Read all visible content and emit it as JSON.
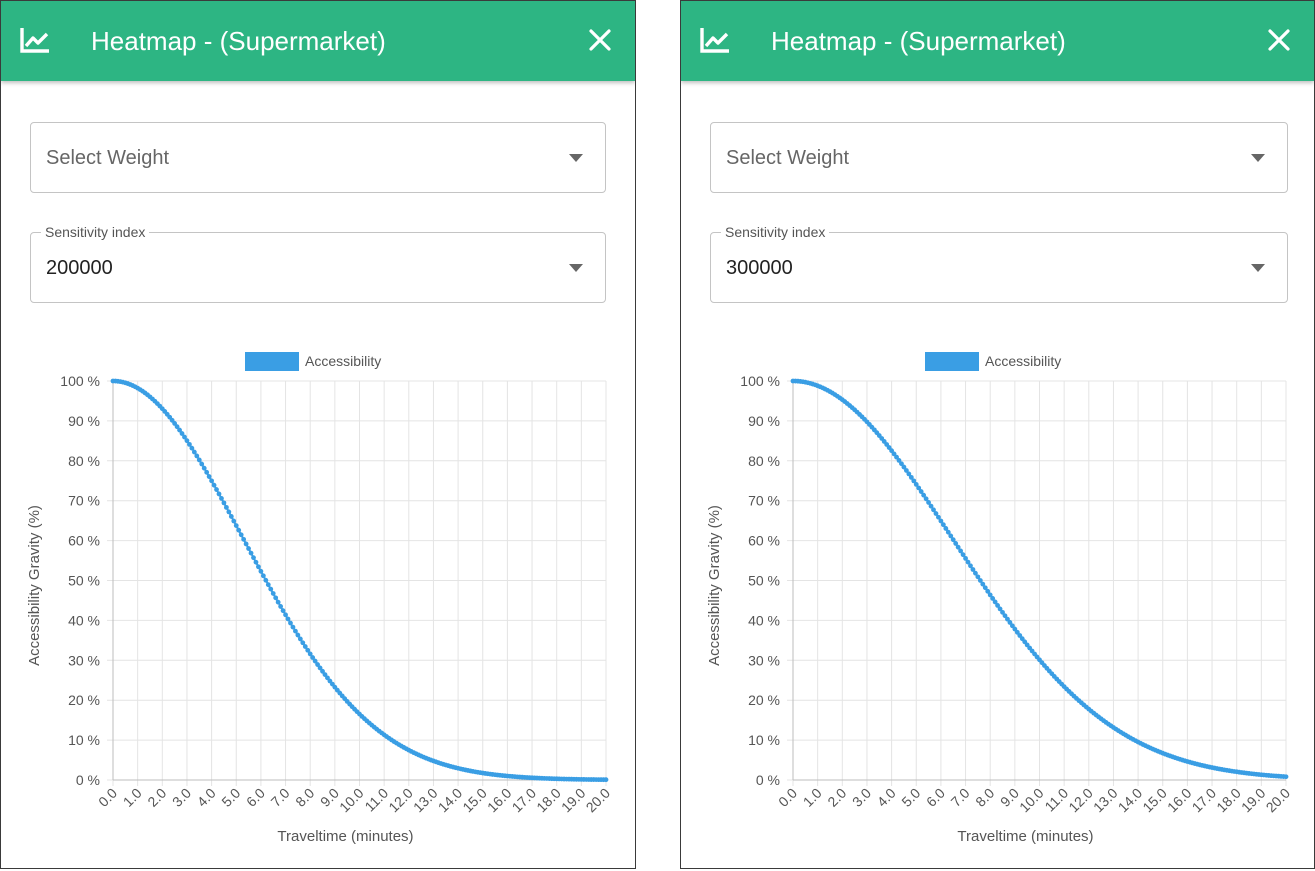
{
  "panels": [
    {
      "header": {
        "title": "Heatmap - (Supermarket)",
        "icon": "chart-line-icon",
        "close_icon": "close-icon"
      },
      "weight_select": {
        "placeholder": "Select Weight"
      },
      "sensitivity_select": {
        "label": "Sensitivity index",
        "value": "200000"
      },
      "legend": {
        "label": "Accessibility",
        "color": "#3a9ee4"
      },
      "chart_data": {
        "type": "line",
        "series": [
          {
            "name": "Accessibility",
            "sensitivity": 200000
          }
        ],
        "x_ticks": [
          "0.0",
          "1.0",
          "2.0",
          "3.0",
          "4.0",
          "5.0",
          "6.0",
          "7.0",
          "8.0",
          "9.0",
          "10.0",
          "11.0",
          "12.0",
          "13.0",
          "14.0",
          "15.0",
          "16.0",
          "17.0",
          "18.0",
          "19.0",
          "20.0"
        ],
        "y_ticks": [
          "0 %",
          "10 %",
          "20 %",
          "30 %",
          "40 %",
          "50 %",
          "60 %",
          "70 %",
          "80 %",
          "90 %",
          "100 %"
        ],
        "xlabel": "Traveltime (minutes)",
        "ylabel": "Accessibility Gravity (%)",
        "xlim": [
          0,
          20
        ],
        "ylim": [
          0,
          100
        ],
        "grid": true,
        "legend_position": "top"
      }
    },
    {
      "header": {
        "title": "Heatmap - (Supermarket)",
        "icon": "chart-line-icon",
        "close_icon": "close-icon"
      },
      "weight_select": {
        "placeholder": "Select Weight"
      },
      "sensitivity_select": {
        "label": "Sensitivity index",
        "value": "300000"
      },
      "legend": {
        "label": "Accessibility",
        "color": "#3a9ee4"
      },
      "chart_data": {
        "type": "line",
        "series": [
          {
            "name": "Accessibility",
            "sensitivity": 300000
          }
        ],
        "x_ticks": [
          "0.0",
          "1.0",
          "2.0",
          "3.0",
          "4.0",
          "5.0",
          "6.0",
          "7.0",
          "8.0",
          "9.0",
          "10.0",
          "11.0",
          "12.0",
          "13.0",
          "14.0",
          "15.0",
          "16.0",
          "17.0",
          "18.0",
          "19.0",
          "20.0"
        ],
        "y_ticks": [
          "0 %",
          "10 %",
          "20 %",
          "30 %",
          "40 %",
          "50 %",
          "60 %",
          "70 %",
          "80 %",
          "90 %",
          "100 %"
        ],
        "xlabel": "Traveltime (minutes)",
        "ylabel": "Accessibility Gravity (%)",
        "xlim": [
          0,
          20
        ],
        "ylim": [
          0,
          100
        ],
        "grid": true,
        "legend_position": "top"
      }
    }
  ]
}
